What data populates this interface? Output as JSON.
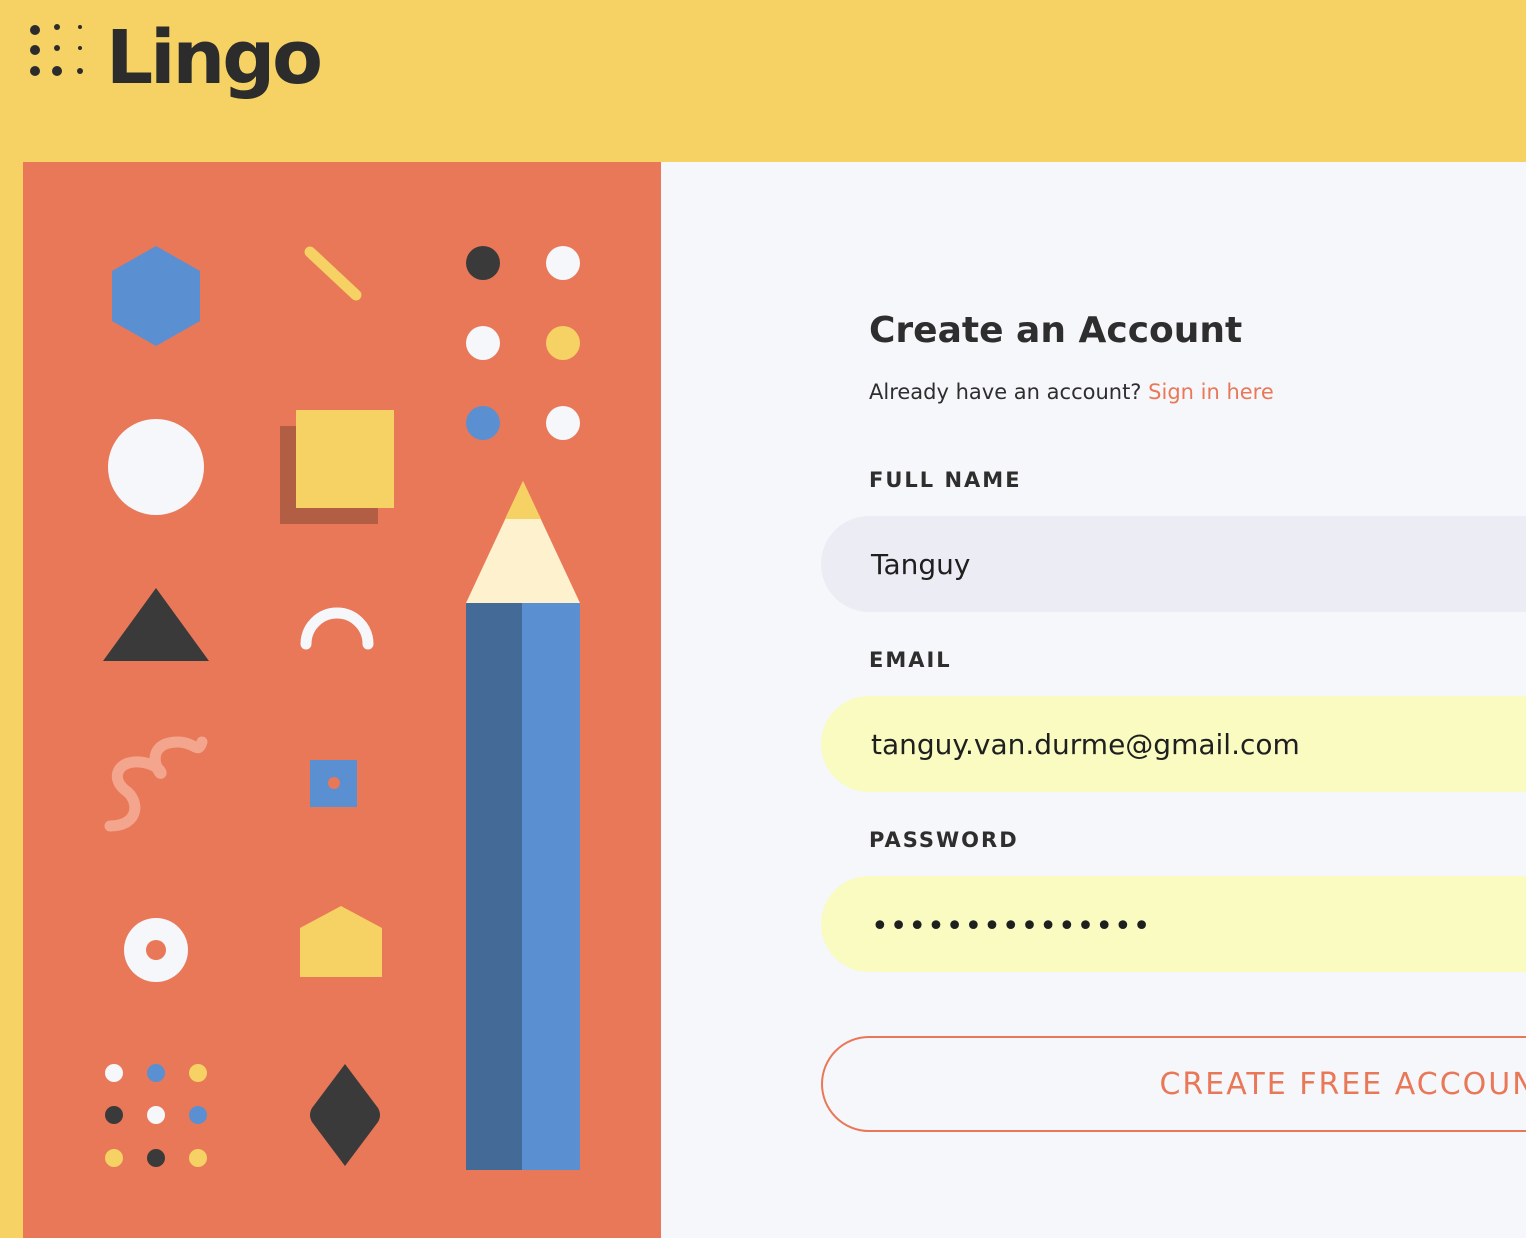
{
  "brand": {
    "name": "Lingo",
    "colors": {
      "header": "#F6D264",
      "art_panel": "#E97858",
      "form_panel": "#F6F7FB",
      "text": "#2e2e2e",
      "accent": "#E97858",
      "field_filled": "#F9FBC1",
      "field_default": "#ECEDF4"
    }
  },
  "illustration": {
    "icons": [
      "hexagon",
      "line",
      "dot-grid",
      "circle",
      "square-with-shadow",
      "triangle",
      "arc",
      "squiggle",
      "small-square",
      "ring",
      "house-shape",
      "diamond",
      "pencil"
    ]
  },
  "form": {
    "title": "Create an Account",
    "subtitle": "Already have an account?",
    "signin_link": "Sign in here",
    "fields": {
      "full_name": {
        "label": "FULL NAME",
        "value": "Tanguy"
      },
      "email": {
        "label": "EMAIL",
        "value": "tanguy.van.durme@gmail.com"
      },
      "password": {
        "label": "PASSWORD",
        "value": "•••••••••••••••"
      }
    },
    "submit_label": "CREATE FREE ACCOUNT"
  }
}
